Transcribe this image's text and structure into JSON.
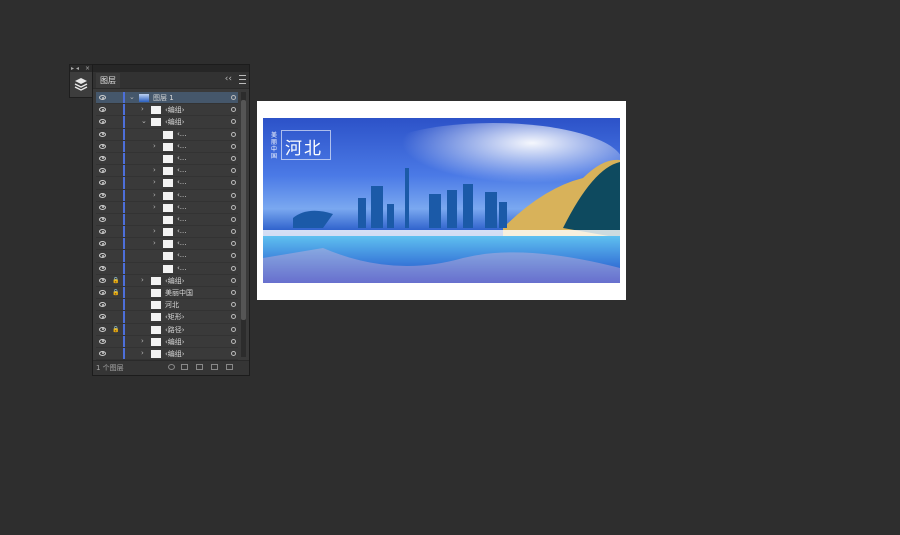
{
  "toolstrip": {
    "grip": "▸◂ ×",
    "layers_tool": "layers-icon"
  },
  "panel": {
    "tab_label": "图层",
    "collapse_label": "‹‹",
    "footer_count": "1 个图层",
    "rows": [
      {
        "label": "图层 1",
        "indent": 0,
        "expander": "⌄",
        "selected": true,
        "lock": false,
        "thumb": "blue"
      },
      {
        "label": "‹编组›",
        "indent": 1,
        "expander": "›",
        "selected": false,
        "lock": false,
        "thumb": "white"
      },
      {
        "label": "‹编组›",
        "indent": 1,
        "expander": "⌄",
        "selected": false,
        "lock": false,
        "thumb": "white"
      },
      {
        "label": "‹...",
        "indent": 2,
        "expander": "",
        "selected": false,
        "lock": false,
        "thumb": "white"
      },
      {
        "label": "‹...",
        "indent": 2,
        "expander": "›",
        "selected": false,
        "lock": false,
        "thumb": "white"
      },
      {
        "label": "‹...",
        "indent": 2,
        "expander": "",
        "selected": false,
        "lock": false,
        "thumb": "white"
      },
      {
        "label": "‹...",
        "indent": 2,
        "expander": "›",
        "selected": false,
        "lock": false,
        "thumb": "white"
      },
      {
        "label": "‹...",
        "indent": 2,
        "expander": "›",
        "selected": false,
        "lock": false,
        "thumb": "white"
      },
      {
        "label": "‹...",
        "indent": 2,
        "expander": "›",
        "selected": false,
        "lock": false,
        "thumb": "white"
      },
      {
        "label": "‹...",
        "indent": 2,
        "expander": "›",
        "selected": false,
        "lock": false,
        "thumb": "white"
      },
      {
        "label": "‹...",
        "indent": 2,
        "expander": "",
        "selected": false,
        "lock": false,
        "thumb": "white"
      },
      {
        "label": "‹...",
        "indent": 2,
        "expander": "›",
        "selected": false,
        "lock": false,
        "thumb": "white"
      },
      {
        "label": "‹...",
        "indent": 2,
        "expander": "›",
        "selected": false,
        "lock": false,
        "thumb": "white"
      },
      {
        "label": "‹...",
        "indent": 2,
        "expander": "",
        "selected": false,
        "lock": false,
        "thumb": "white"
      },
      {
        "label": "‹...",
        "indent": 2,
        "expander": "",
        "selected": false,
        "lock": false,
        "thumb": "white"
      },
      {
        "label": "‹编组›",
        "indent": 1,
        "expander": "›",
        "selected": false,
        "lock": true,
        "thumb": "white"
      },
      {
        "label": "美丽中国",
        "indent": 1,
        "expander": "",
        "selected": false,
        "lock": true,
        "thumb": "white"
      },
      {
        "label": "河北",
        "indent": 1,
        "expander": "",
        "selected": false,
        "lock": false,
        "thumb": "white"
      },
      {
        "label": "‹矩形›",
        "indent": 1,
        "expander": "",
        "selected": false,
        "lock": false,
        "thumb": "white"
      },
      {
        "label": "‹路径›",
        "indent": 1,
        "expander": "",
        "selected": false,
        "lock": true,
        "thumb": "white"
      },
      {
        "label": "‹编组›",
        "indent": 1,
        "expander": "›",
        "selected": false,
        "lock": false,
        "thumb": "white"
      },
      {
        "label": "‹编组›",
        "indent": 1,
        "expander": "›",
        "selected": false,
        "lock": false,
        "thumb": "white"
      }
    ]
  },
  "artwork": {
    "title": "河北",
    "subtitle": "美丽中国"
  },
  "colors": {
    "selection": "#45576b",
    "layer_bar": "#4d6fd9",
    "canvas_bg": "#2e2e2e"
  }
}
